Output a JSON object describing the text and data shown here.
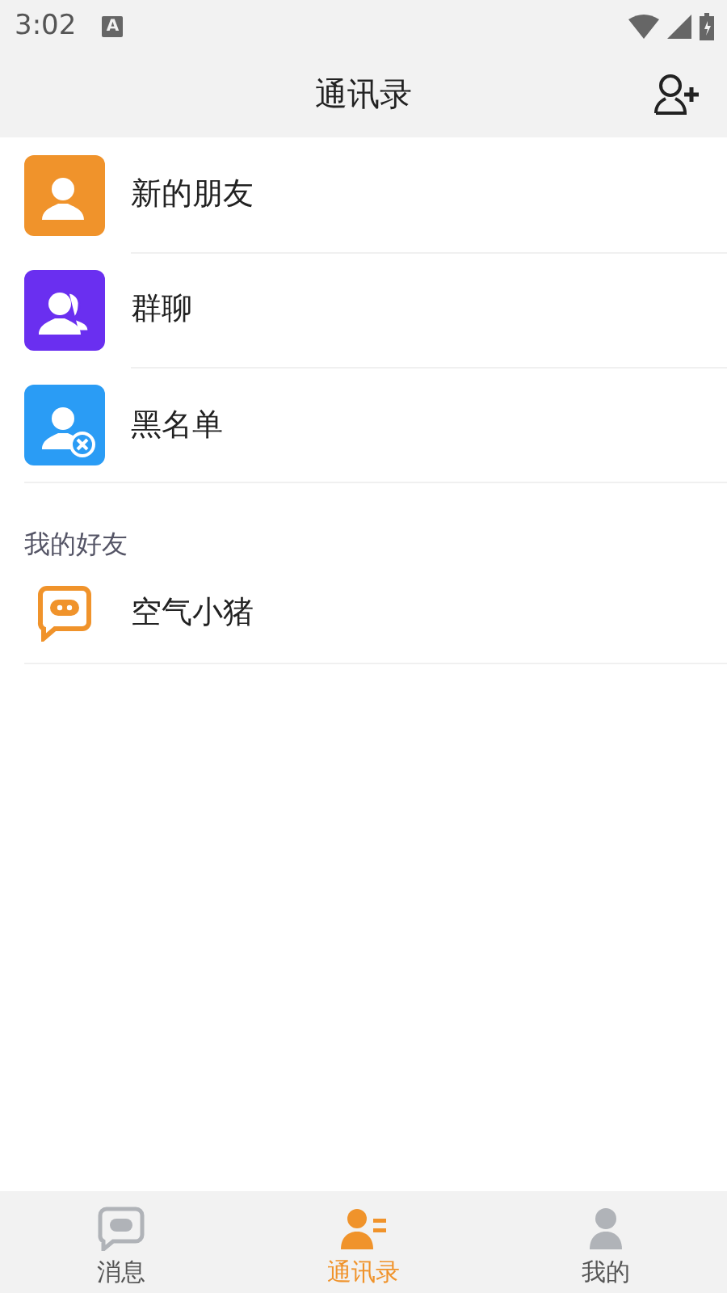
{
  "status_bar": {
    "time": "3:02",
    "notification": "A"
  },
  "header": {
    "title": "通讯录"
  },
  "entries": [
    {
      "kind": "new-friend",
      "label": "新的朋友"
    },
    {
      "kind": "group",
      "label": "群聊"
    },
    {
      "kind": "blocked",
      "label": "黑名单"
    }
  ],
  "friends": {
    "heading": "我的好友",
    "items": [
      {
        "name": "空气小猪"
      }
    ]
  },
  "tabs": [
    {
      "kind": "chat",
      "label": "消息",
      "selected": false
    },
    {
      "kind": "contacts",
      "label": "通讯录",
      "selected": true
    },
    {
      "kind": "me",
      "label": "我的",
      "selected": false
    }
  ]
}
